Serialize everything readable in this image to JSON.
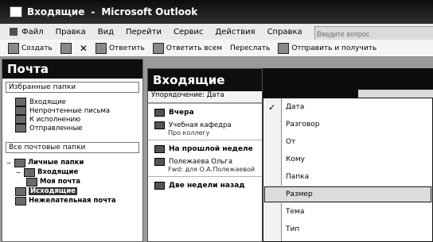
{
  "window": {
    "title_left": "Входящие",
    "title_sep": "-",
    "title_right": "Microsoft Outlook"
  },
  "menubar": {
    "items": [
      "Файл",
      "Правка",
      "Вид",
      "Перейти",
      "Сервис",
      "Действия",
      "Справка"
    ],
    "search_placeholder": "Введите вопрос"
  },
  "toolbar": {
    "create": "Создать",
    "reply": "Ответить",
    "reply_all": "Ответить всем",
    "forward": "Переслать",
    "send_receive": "Отправить и получить"
  },
  "left_pane": {
    "header": "Почта",
    "favorites_title": "Избранные папки",
    "favorites": [
      "Входящие",
      "Непрочтенные письма",
      "К исполнению",
      "Отправленные"
    ],
    "all_folders_title": "Все почтовые папки",
    "tree": [
      {
        "label": "Личные папки",
        "level": 0,
        "expander": "−"
      },
      {
        "label": "Входящие",
        "level": 1,
        "expander": "−"
      },
      {
        "label": "Моя почта",
        "level": 2,
        "expander": ""
      },
      {
        "label": "Исходящие",
        "level": 1,
        "expander": ""
      },
      {
        "label": "Нежелательная почта",
        "level": 1,
        "expander": ""
      }
    ]
  },
  "mid_pane": {
    "header": "Входящие",
    "arranged_by": "Упорядочение: Дата",
    "groups": [
      {
        "label": "Вчера"
      },
      {
        "label": "На прошлой неделе"
      },
      {
        "label": "Две недели назад"
      }
    ],
    "mails": [
      {
        "from": "Учебная кафедра",
        "subject": "Про коллегу"
      },
      {
        "from": "Полежаева Ольга",
        "subject": "Fwd: для О.А.Полежаевой"
      }
    ]
  },
  "dropdown": {
    "checked_symbol": "✓",
    "items": [
      "Дата",
      "Разговор",
      "От",
      "Кому",
      "Папка",
      "Размер",
      "Тема",
      "Тип"
    ],
    "checked_index": 0,
    "highlighted_index": 5
  }
}
